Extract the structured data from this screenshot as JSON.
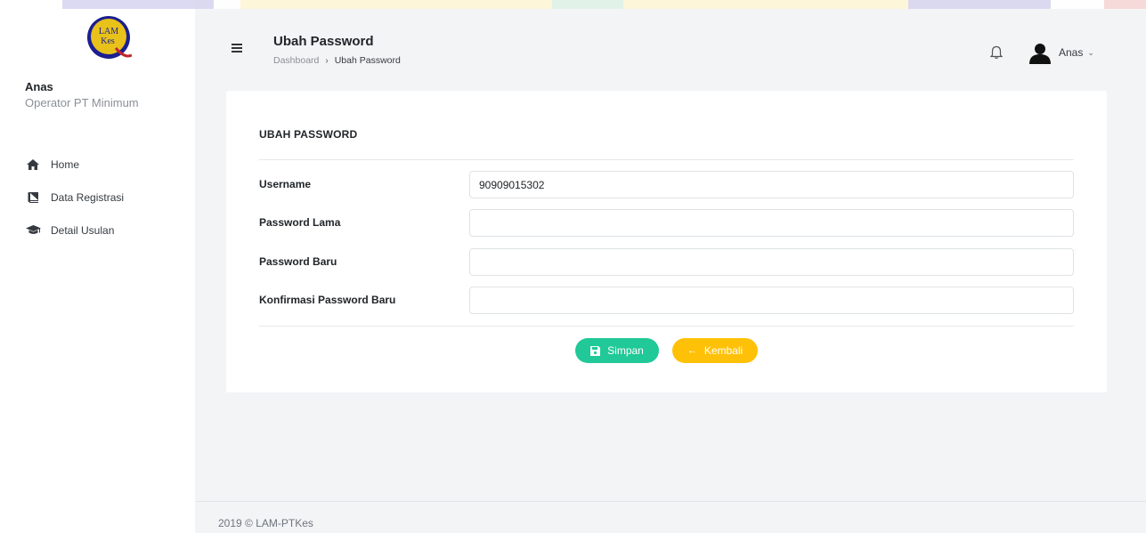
{
  "brand": {
    "logo_text_top": "LAM",
    "logo_text_bottom": "Kes",
    "colors": {
      "logo_blue": "#1b1f8f",
      "logo_gold": "#e8c21a",
      "logo_red": "#c0262c"
    }
  },
  "sidebar": {
    "user_name": "Anas",
    "user_role": "Operator PT Minimum",
    "items": [
      {
        "label": "Home",
        "icon": "home-icon"
      },
      {
        "label": "Data Registrasi",
        "icon": "book-icon"
      },
      {
        "label": "Detail Usulan",
        "icon": "graduation-cap-icon"
      }
    ]
  },
  "header": {
    "title": "Ubah Password",
    "breadcrumb": {
      "root": "Dashboard",
      "separator": "›",
      "current": "Ubah Password"
    },
    "user_name": "Anas",
    "user_chevron": "⌄"
  },
  "form": {
    "title": "UBAH PASSWORD",
    "fields": [
      {
        "label": "Username",
        "value": "90909015302"
      },
      {
        "label": "Password Lama",
        "value": ""
      },
      {
        "label": "Password Baru",
        "value": ""
      },
      {
        "label": "Konfirmasi Password Baru",
        "value": ""
      }
    ],
    "save_label": "Simpan",
    "back_label": "Kembali",
    "back_arrow": "←",
    "colors": {
      "save": "#20c997",
      "back": "#ffc107"
    }
  },
  "footer": {
    "text": "2019 © LAM-PTKes"
  }
}
